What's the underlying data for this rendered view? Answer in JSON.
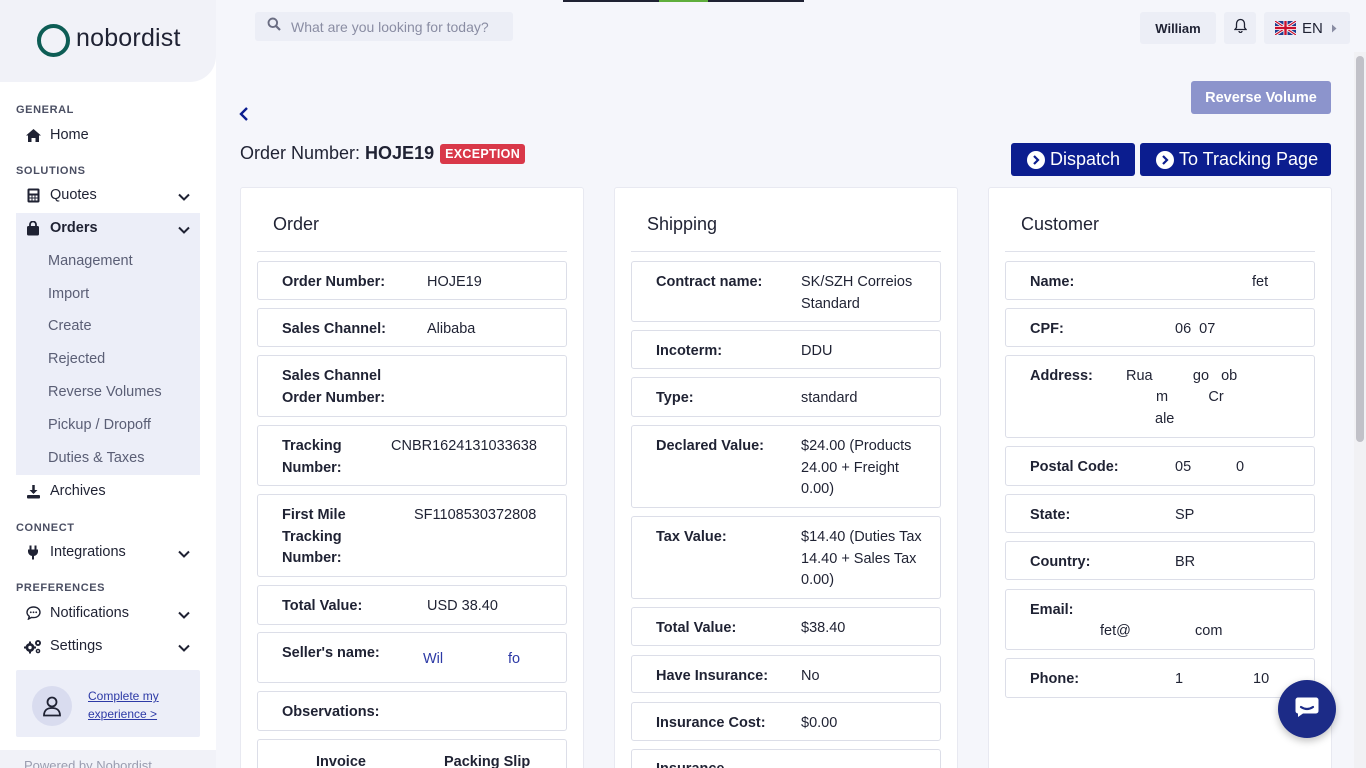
{
  "brand": {
    "name": "nobordist"
  },
  "sidebar": {
    "sections": {
      "general": "GENERAL",
      "solutions": "SOLUTIONS",
      "connect": "CONNECT",
      "preferences": "PREFERENCES"
    },
    "items": {
      "home": "Home",
      "quotes": "Quotes",
      "orders": "Orders",
      "archives": "Archives",
      "integrations": "Integrations",
      "notifications": "Notifications",
      "settings": "Settings"
    },
    "orders_sub": [
      "Management",
      "Import",
      "Create",
      "Rejected",
      "Reverse Volumes",
      "Pickup / Dropoff",
      "Duties & Taxes"
    ],
    "complete_link": "Complete my experience >",
    "powered_by": "Powered by Nobordist"
  },
  "topbar": {
    "search_placeholder": "What are you looking for today?",
    "user": "William",
    "language": "EN"
  },
  "page": {
    "reverse_button": "Reverse Volume",
    "order_label": "Order Number:",
    "order_number": "HOJE19",
    "status_badge": "EXCEPTION",
    "dispatch_button": "Dispatch",
    "tracking_button": "To Tracking Page"
  },
  "order_card": {
    "title": "Order",
    "rows": [
      {
        "label": "Order Number:",
        "value": "HOJE19"
      },
      {
        "label": "Sales Channel:",
        "value": "Alibaba"
      },
      {
        "label": "Sales Channel Order Number:",
        "value": ""
      },
      {
        "label": "Tracking Number:",
        "value": "CNBR1624131033638"
      },
      {
        "label": "First Mile Tracking Number:",
        "value": "SF1108530372808"
      },
      {
        "label": "Total Value:",
        "value": "USD 38.40"
      },
      {
        "label": "Seller's name:",
        "value_a": "Wil",
        "value_b": "fo"
      },
      {
        "label": "Observations:",
        "value": ""
      }
    ],
    "footer_cols": [
      "Invoice",
      "Packing Slip"
    ]
  },
  "shipping_card": {
    "title": "Shipping",
    "rows": [
      {
        "label": "Contract name:",
        "value": "SK/SZH Correios Standard"
      },
      {
        "label": "Incoterm:",
        "value": "DDU"
      },
      {
        "label": "Type:",
        "value": "standard"
      },
      {
        "label": "Declared Value:",
        "value": "$24.00 (Products 24.00 + Freight 0.00)"
      },
      {
        "label": "Tax Value:",
        "value": "$14.40 (Duties Tax 14.40 + Sales Tax 0.00)"
      },
      {
        "label": "Total Value:",
        "value": "$38.40"
      },
      {
        "label": "Have Insurance:",
        "value": "No"
      },
      {
        "label": "Insurance Cost:",
        "value": "$0.00"
      },
      {
        "label": "Insurance",
        "value": ""
      }
    ]
  },
  "customer_card": {
    "title": "Customer",
    "rows": [
      {
        "label": "Name:",
        "value": "fet"
      },
      {
        "label": "CPF:",
        "value": "06  07"
      },
      {
        "label": "Address:",
        "line1": "Rua          go   ob",
        "line2": "m          Cr",
        "line3": "ale"
      },
      {
        "label": "Postal Code:",
        "value_a": "05",
        "value_b": "0"
      },
      {
        "label": "State:",
        "value": "SP"
      },
      {
        "label": "Country:",
        "value": "BR"
      },
      {
        "label": "Email:",
        "value_a": "fet@",
        "value_b": "com"
      },
      {
        "label": "Phone:",
        "value_a": "1",
        "value_b": "10"
      }
    ]
  },
  "colors": {
    "primary": "#0b1d8f",
    "badge": "#d93849",
    "reverse_button": "#8c94cc",
    "logo_ring": "#0d5d55"
  }
}
